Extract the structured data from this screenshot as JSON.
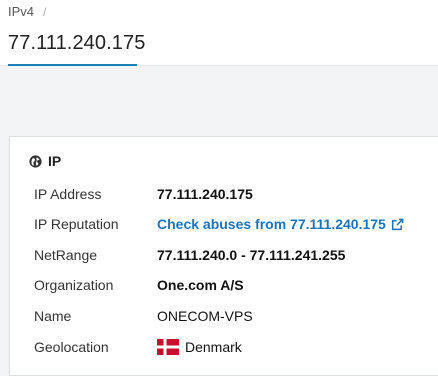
{
  "breadcrumb": {
    "item": "IPv4",
    "separator": "/"
  },
  "page_title": "77.111.240.175",
  "card": {
    "heading": "IP",
    "heading_icon": "globe-icon",
    "rows": [
      {
        "label": "IP Address",
        "value": "77.111.240.175"
      },
      {
        "label": "IP Reputation",
        "value": "Check abuses from 77.111.240.175",
        "icon": "external-link-icon"
      },
      {
        "label": "NetRange",
        "value": "77.111.240.0 - 77.111.241.255"
      },
      {
        "label": "Organization",
        "value": "One.com A/S"
      },
      {
        "label": "Name",
        "value": "ONECOM-VPS"
      },
      {
        "label": "Geolocation",
        "value": "Denmark",
        "icon": "denmark-flag-icon"
      }
    ]
  },
  "colors": {
    "accent": "#1d7fb8",
    "link": "#1a73b8",
    "flag_red": "#c8102e"
  }
}
